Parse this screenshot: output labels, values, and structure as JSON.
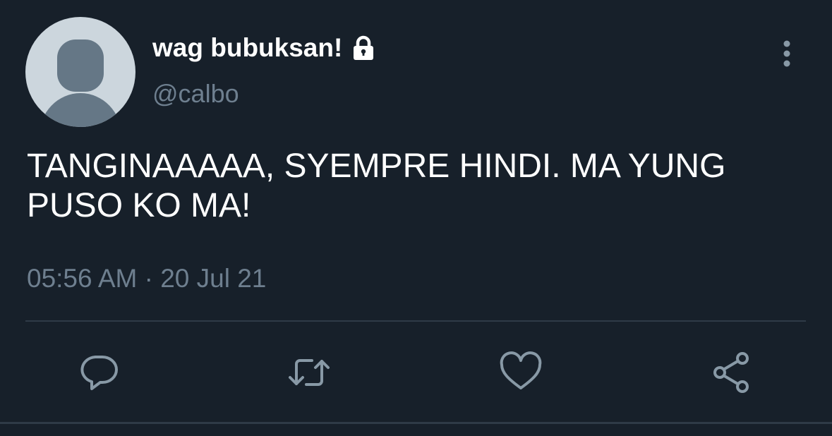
{
  "user": {
    "display_name": "wag bubuksan!",
    "handle": "@calbo",
    "protected_icon": "lock-icon",
    "avatar": "default-avatar-silhouette"
  },
  "tweet": {
    "text": "TANGINAAAAA, SYEMPRE HINDI. MA YUNG PUSO KO MA!",
    "timestamp": "05:56 AM · 20 Jul 21"
  },
  "actions": [
    {
      "name": "reply",
      "icon": "speech-bubble-icon"
    },
    {
      "name": "retweet",
      "icon": "retweet-arrows-icon"
    },
    {
      "name": "like",
      "icon": "heart-icon"
    },
    {
      "name": "share",
      "icon": "share-icon"
    }
  ],
  "menu_icon": "more-vertical-icon",
  "colors": {
    "background": "#17202a",
    "primary_text": "#ffffff",
    "secondary_text": "#6e7f8f",
    "icon": "#8899a6",
    "divider": "#2f3b47",
    "avatar_bg": "#ccd6dd",
    "avatar_figure": "#657786"
  }
}
